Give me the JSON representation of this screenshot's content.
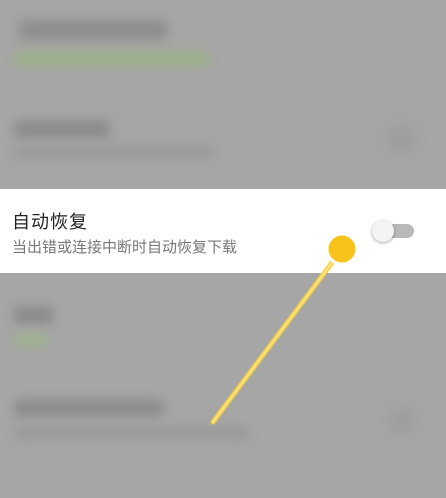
{
  "setting": {
    "title": "自动恢复",
    "description": "当出错或连接中断时自动恢复下载",
    "toggle_on": false
  },
  "colors": {
    "dim_overlay": "#a6a6a6",
    "highlight_row": "#ffffff",
    "touch_point": "#f7c31a",
    "swipe_line": "#f5d041"
  },
  "icons": {
    "touch_indicator": "touch-point-icon",
    "swipe_trail": "swipe-trail-icon"
  }
}
